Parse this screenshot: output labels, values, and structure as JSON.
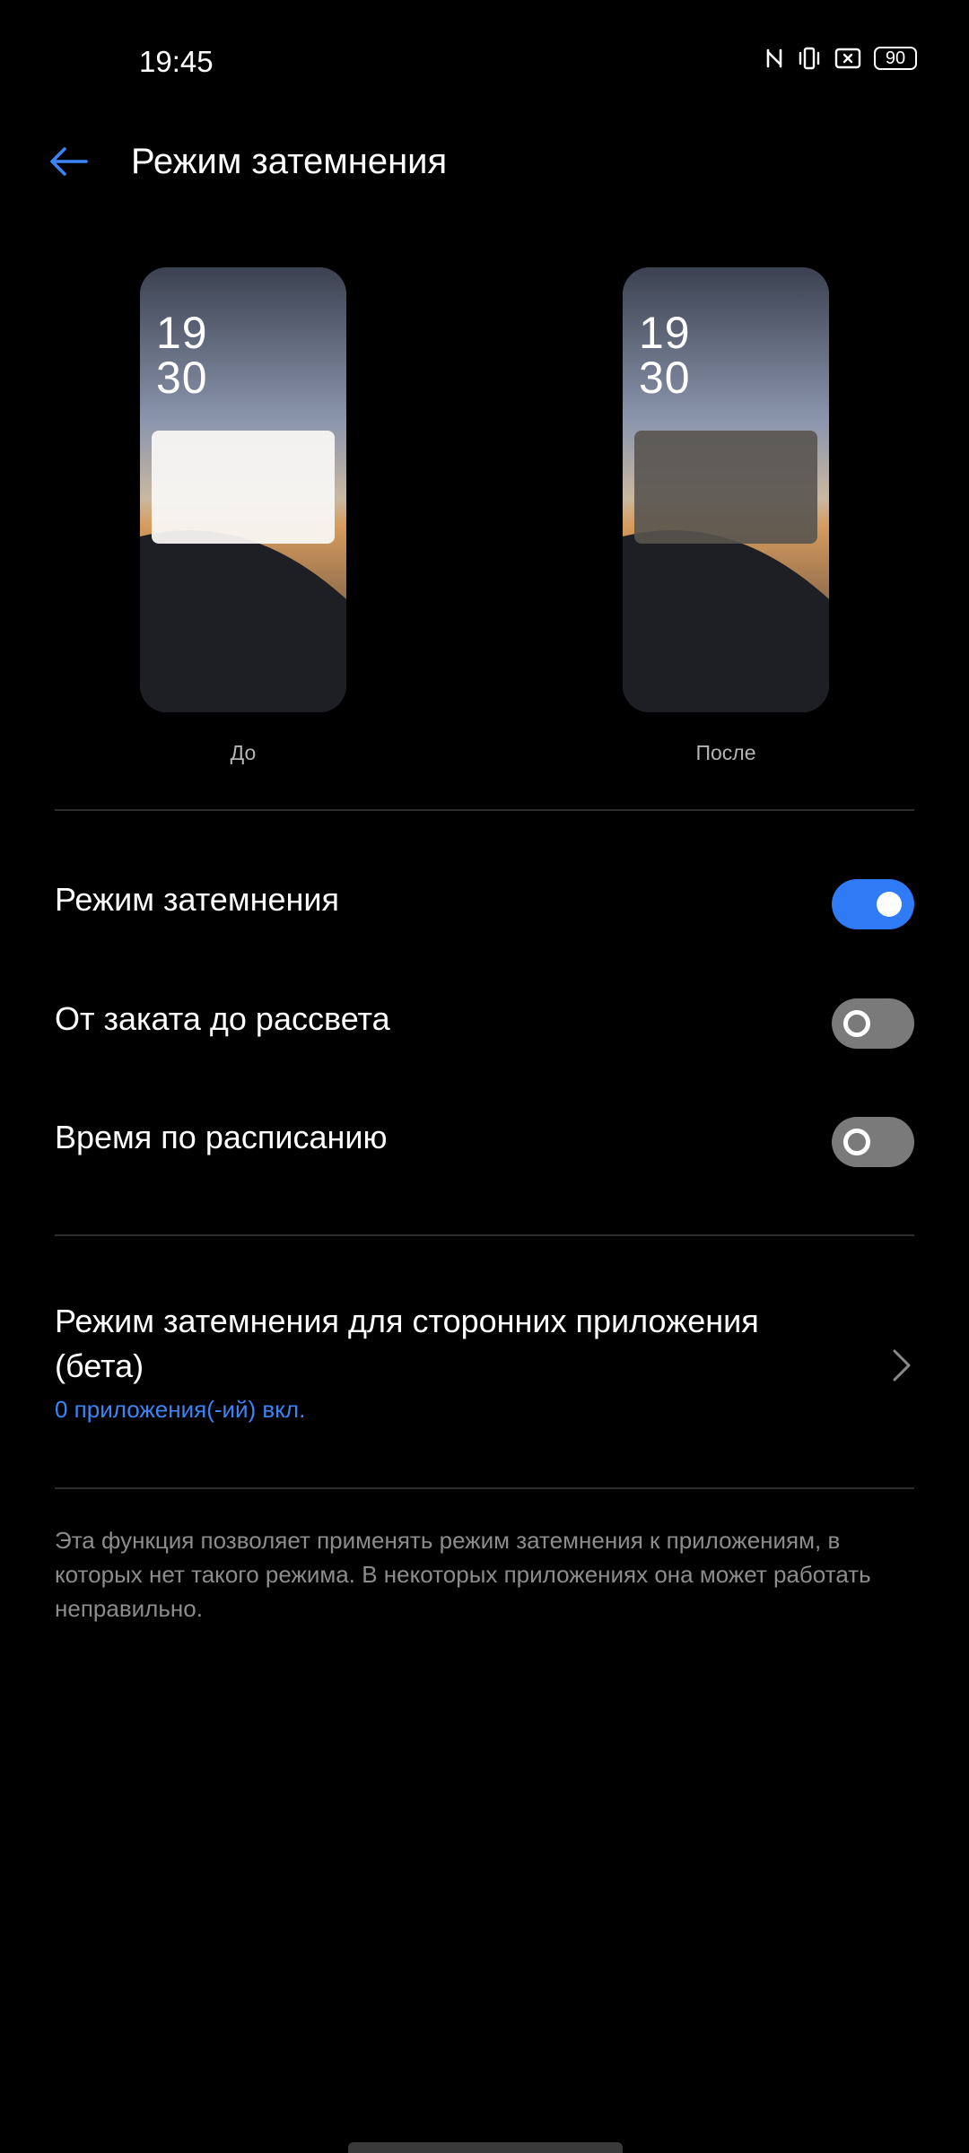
{
  "status_bar": {
    "time": "19:45",
    "battery": "90",
    "icons": [
      "nfc-icon",
      "vibrate-icon",
      "no-sim-icon",
      "battery-icon"
    ]
  },
  "header": {
    "back_icon": "arrow-left-icon",
    "title": "Режим затемнения"
  },
  "previews": [
    {
      "caption": "До",
      "clock_hours": "19",
      "clock_minutes": "30"
    },
    {
      "caption": "После",
      "clock_hours": "19",
      "clock_minutes": "30"
    }
  ],
  "settings": [
    {
      "label": "Режим затемнения",
      "enabled": true
    },
    {
      "label": "От заката до рассвета",
      "enabled": false
    },
    {
      "label": "Время по расписанию",
      "enabled": false
    }
  ],
  "third_party": {
    "title": "Режим затемнения для сторонних приложения (бета)",
    "subtitle": "0 приложения(-ий) вкл."
  },
  "note": "Эта функция позволяет применять режим затемнения к приложениям, в которых нет такого режима. В некоторых приложениях она может работать неправильно.",
  "colors": {
    "background": "#000000",
    "accent": "#2f7bf5",
    "link_text": "#3d84f7",
    "toggle_off": "#7a7a7a"
  }
}
